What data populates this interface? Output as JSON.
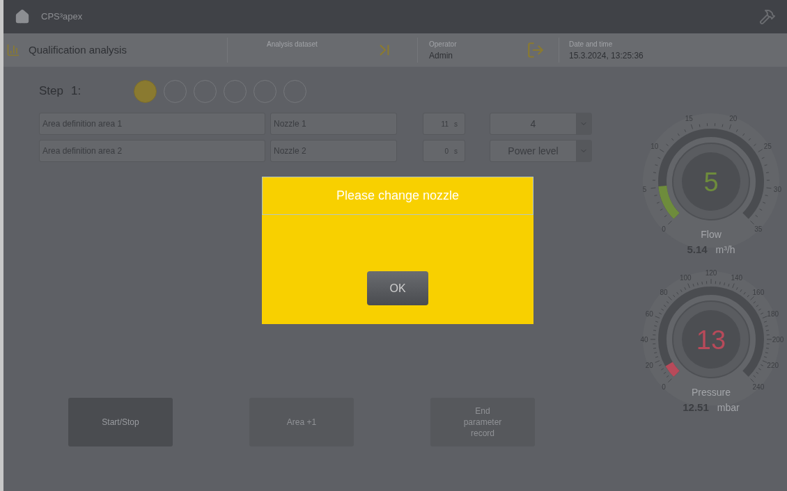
{
  "titlebar": {
    "title": "CPS³apex"
  },
  "header": {
    "title": "Qualification analysis",
    "dataset_label": "Analysis dataset",
    "operator_label": "Operator",
    "operator": "Admin",
    "datetime_label": "Date and time",
    "datetime": "15.3.2024, 13:25:36"
  },
  "step": {
    "label": "Step",
    "number": "1:",
    "circles": [
      {
        "selected": true
      },
      {
        "selected": false
      },
      {
        "selected": false
      },
      {
        "selected": false
      },
      {
        "selected": false
      },
      {
        "selected": false
      }
    ]
  },
  "rows": [
    {
      "area": "Area definition area 1",
      "nozzle": "Nozzle 1",
      "time": "11",
      "unit": "s",
      "select": "4"
    },
    {
      "area": "Area definition area 2",
      "nozzle": "Nozzle 2",
      "time": "0",
      "unit": "s",
      "select": "Power level"
    }
  ],
  "gauges": [
    {
      "name": "Flow",
      "display": "5",
      "value": "5.14",
      "unit": "m³/h",
      "level": 0.147,
      "color": "#6e8c3c",
      "scale_labels": [
        "0",
        "5",
        "10",
        "15",
        "20",
        "25",
        "30",
        "35"
      ]
    },
    {
      "name": "Pressure",
      "display": "13",
      "value": "12.51",
      "unit": "mbar",
      "level": 0.054,
      "color": "#b84a5a",
      "scale_labels": [
        "0",
        "20",
        "40",
        "60",
        "80",
        "100",
        "120",
        "140",
        "160",
        "180",
        "200",
        "220",
        "240"
      ]
    }
  ],
  "buttons": [
    {
      "label": "Start/Stop",
      "disabled": false
    },
    {
      "label": "Area +1",
      "disabled": true
    },
    {
      "label": "End parameter record",
      "disabled": true
    }
  ],
  "dialog": {
    "title": "Please change nozzle",
    "button": "OK"
  }
}
